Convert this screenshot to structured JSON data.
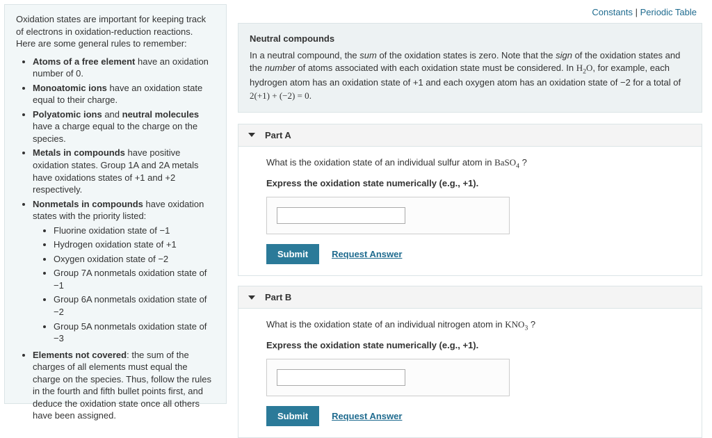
{
  "top_links": {
    "constants": "Constants",
    "sep": " | ",
    "periodic": "Periodic Table"
  },
  "sidebar": {
    "intro": "Oxidation states are important for keeping track of electrons in oxidation-reduction reactions. Here are some general rules to remember:",
    "r1a": "Atoms of a free element",
    "r1b": " have an oxidation number of 0.",
    "r2a": "Monoatomic ions",
    "r2b": " have an oxidation state equal to their charge.",
    "r3a": "Polyatomic ions",
    "r3and": " and ",
    "r3b": "neutral molecules",
    "r3c": " have a charge equal to the charge on the species.",
    "r4a": "Metals in compounds",
    "r4b": " have positive oxidation states. Group 1A and 2A metals have oxidations states of +1 and +2 respectively.",
    "r5a": "Nonmetals in compounds",
    "r5b": " have oxidation states with the priority listed:",
    "sub1": "Fluorine oxidation state of −1",
    "sub2": "Hydrogen oxidation state of +1",
    "sub3": "Oxygen oxidation state of −2",
    "sub4": "Group 7A nonmetals oxidation state of −1",
    "sub5": "Group 6A nonmetals oxidation state of −2",
    "sub6": "Group 5A nonmetals oxidation state of −3",
    "r6a": "Elements not covered",
    "r6b": ": the sum of the charges of all elements must equal the charge on the species. Thus, follow the rules in the fourth and fifth bullet points first, and deduce the oxidation state once all others have been assigned."
  },
  "infobox": {
    "title": "Neutral compounds",
    "t1": "In a neutral compound, the ",
    "sum": "sum",
    "t2": " of the oxidation states is zero. Note that the ",
    "sign": "sign",
    "t3": " of the oxidation states and the ",
    "number": "number",
    "t4": " of atoms associated with each oxidation state must be considered. In ",
    "h2o_h": "H",
    "h2o_2": "2",
    "h2o_o": "O",
    "t5": ", for example, each hydrogen atom has an oxidation state of +1 and each oxygen atom has an oxidation state of −2 for a total of ",
    "eq": "2(+1) + (−2) = 0",
    "t6": "."
  },
  "partA": {
    "header": "Part A",
    "q1": "What is the oxidation state of an individual sulfur atom in ",
    "f_ba": "Ba",
    "f_s": "S",
    "f_o": "O",
    "f_4": "4",
    "qend": " ?",
    "instruct": "Express the oxidation state numerically (e.g., +1).",
    "value": "",
    "submit": "Submit",
    "request": "Request Answer"
  },
  "partB": {
    "header": "Part B",
    "q1": "What is the oxidation state of an individual nitrogen atom in ",
    "f_k": "K",
    "f_n": "N",
    "f_o": "O",
    "f_3": "3",
    "qend": "  ?",
    "instruct": "Express the oxidation state numerically (e.g., +1).",
    "value": "",
    "submit": "Submit",
    "request": "Request Answer"
  }
}
